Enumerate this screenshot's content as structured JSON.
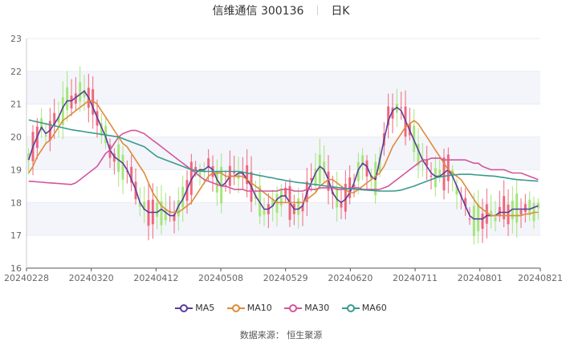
{
  "header": {
    "stock_name": "信维通信",
    "stock_code": "300136",
    "period": "日K"
  },
  "source_text": "数据来源： 恒生聚源",
  "colors": {
    "up": "#a4e67a",
    "down": "#f0667b",
    "grid": "#e8ecf4",
    "band": "#f3f5fb",
    "axis": "#666666"
  },
  "chart_data": {
    "type": "candlestick",
    "ylim": [
      16,
      23
    ],
    "y_ticks": [
      "16",
      "17",
      "18",
      "19",
      "20",
      "21",
      "22",
      "23"
    ],
    "x_tick_labels": [
      "20240228",
      "20240320",
      "20240412",
      "20240508",
      "20240529",
      "20240620",
      "20240711",
      "20240801",
      "20240821"
    ],
    "x_tick_indices": [
      0,
      15,
      30,
      45,
      60,
      75,
      90,
      105,
      119
    ],
    "moving_averages": [
      {
        "name": "MA5",
        "color": "#5a3d9a",
        "values": [
          19.3,
          19.7,
          20.0,
          20.3,
          20.1,
          20.2,
          20.4,
          20.6,
          20.9,
          21.1,
          21.1,
          21.2,
          21.3,
          21.4,
          21.2,
          20.9,
          20.6,
          20.3,
          20.0,
          19.6,
          19.4,
          19.3,
          19.2,
          19.0,
          18.7,
          18.4,
          18.0,
          17.8,
          17.7,
          17.7,
          17.7,
          17.8,
          17.7,
          17.6,
          17.6,
          17.9,
          18.1,
          18.4,
          18.7,
          18.9,
          19.0,
          19.0,
          19.1,
          19.0,
          18.7,
          18.5,
          18.6,
          18.8,
          18.8,
          18.9,
          18.9,
          18.7,
          18.5,
          18.2,
          18.0,
          17.8,
          17.8,
          17.9,
          18.1,
          18.2,
          18.2,
          18.0,
          17.8,
          17.8,
          17.9,
          18.3,
          18.6,
          18.9,
          19.1,
          19.0,
          18.7,
          18.3,
          18.1,
          18.0,
          18.1,
          18.3,
          18.6,
          19.0,
          19.2,
          19.1,
          18.8,
          18.7,
          19.3,
          19.9,
          20.5,
          20.8,
          20.9,
          20.8,
          20.5,
          20.2,
          19.9,
          19.6,
          19.3,
          19.1,
          18.9,
          18.8,
          18.8,
          18.9,
          19.0,
          18.8,
          18.5,
          18.2,
          17.9,
          17.6,
          17.5,
          17.5,
          17.5,
          17.6,
          17.6,
          17.6,
          17.7,
          17.7,
          17.7,
          17.8,
          17.8,
          17.8,
          17.8,
          17.8,
          17.85,
          17.9
        ]
      },
      {
        "name": "MA10",
        "color": "#e08a3a",
        "values": [
          18.9,
          19.1,
          19.4,
          19.6,
          19.8,
          19.9,
          20.1,
          20.3,
          20.5,
          20.6,
          20.7,
          20.8,
          20.9,
          21.0,
          21.1,
          21.1,
          21.0,
          20.8,
          20.6,
          20.4,
          20.2,
          20.0,
          19.8,
          19.7,
          19.5,
          19.3,
          19.1,
          18.9,
          18.6,
          18.3,
          18.1,
          17.9,
          17.8,
          17.7,
          17.7,
          17.7,
          17.8,
          17.9,
          18.0,
          18.2,
          18.4,
          18.6,
          18.8,
          18.9,
          18.9,
          18.9,
          18.8,
          18.8,
          18.8,
          18.8,
          18.8,
          18.7,
          18.6,
          18.5,
          18.4,
          18.3,
          18.2,
          18.1,
          18.0,
          18.0,
          18.0,
          18.0,
          18.0,
          18.0,
          18.0,
          18.1,
          18.2,
          18.3,
          18.5,
          18.6,
          18.7,
          18.7,
          18.6,
          18.5,
          18.4,
          18.3,
          18.3,
          18.4,
          18.5,
          18.6,
          18.7,
          18.8,
          18.9,
          19.1,
          19.4,
          19.7,
          19.9,
          20.1,
          20.3,
          20.4,
          20.5,
          20.4,
          20.2,
          20.0,
          19.8,
          19.6,
          19.4,
          19.2,
          19.0,
          18.9,
          18.8,
          18.7,
          18.5,
          18.3,
          18.1,
          17.9,
          17.8,
          17.7,
          17.6,
          17.6,
          17.6,
          17.6,
          17.6,
          17.6,
          17.6,
          17.6,
          17.65,
          17.65,
          17.7,
          17.7
        ]
      },
      {
        "name": "MA30",
        "color": "#d4559c",
        "values": [
          18.65,
          18.64,
          18.63,
          18.62,
          18.61,
          18.6,
          18.59,
          18.58,
          18.57,
          18.56,
          18.55,
          18.6,
          18.7,
          18.8,
          18.9,
          19.0,
          19.1,
          19.3,
          19.5,
          19.6,
          19.8,
          20.0,
          20.1,
          20.15,
          20.2,
          20.2,
          20.15,
          20.1,
          20.0,
          19.9,
          19.8,
          19.7,
          19.6,
          19.5,
          19.4,
          19.3,
          19.2,
          19.1,
          19.0,
          18.9,
          18.8,
          18.7,
          18.65,
          18.6,
          18.55,
          18.5,
          18.5,
          18.45,
          18.4,
          18.4,
          18.4,
          18.35,
          18.35,
          18.35,
          18.35,
          18.35,
          18.35,
          18.35,
          18.35,
          18.4,
          18.4,
          18.4,
          18.35,
          18.35,
          18.35,
          18.4,
          18.4,
          18.4,
          18.45,
          18.45,
          18.45,
          18.45,
          18.4,
          18.4,
          18.4,
          18.45,
          18.45,
          18.45,
          18.4,
          18.4,
          18.4,
          18.4,
          18.4,
          18.45,
          18.5,
          18.6,
          18.7,
          18.8,
          18.9,
          19.0,
          19.1,
          19.2,
          19.3,
          19.3,
          19.35,
          19.35,
          19.35,
          19.3,
          19.3,
          19.3,
          19.3,
          19.3,
          19.3,
          19.25,
          19.2,
          19.2,
          19.1,
          19.05,
          19.0,
          19.0,
          19.0,
          19.0,
          18.95,
          18.9,
          18.9,
          18.9,
          18.85,
          18.8,
          18.75,
          18.7
        ]
      },
      {
        "name": "MA60",
        "color": "#3a9a8f",
        "values": [
          20.52,
          20.49,
          20.46,
          20.43,
          20.4,
          20.37,
          20.34,
          20.31,
          20.28,
          20.25,
          20.22,
          20.2,
          20.18,
          20.16,
          20.14,
          20.12,
          20.1,
          20.08,
          20.06,
          20.04,
          20.02,
          20.0,
          19.95,
          19.9,
          19.85,
          19.8,
          19.75,
          19.7,
          19.6,
          19.5,
          19.4,
          19.35,
          19.3,
          19.25,
          19.2,
          19.15,
          19.1,
          19.05,
          19.0,
          18.98,
          18.96,
          18.95,
          18.95,
          18.95,
          18.95,
          18.95,
          18.95,
          18.95,
          18.95,
          18.95,
          18.93,
          18.9,
          18.87,
          18.85,
          18.82,
          18.8,
          18.77,
          18.75,
          18.72,
          18.7,
          18.67,
          18.65,
          18.63,
          18.61,
          18.6,
          18.58,
          18.56,
          18.55,
          18.53,
          18.51,
          18.5,
          18.48,
          18.46,
          18.45,
          18.43,
          18.42,
          18.41,
          18.4,
          18.39,
          18.38,
          18.37,
          18.36,
          18.35,
          18.35,
          18.35,
          18.35,
          18.36,
          18.38,
          18.42,
          18.46,
          18.5,
          18.55,
          18.6,
          18.65,
          18.7,
          18.75,
          18.78,
          18.8,
          18.82,
          18.84,
          18.85,
          18.86,
          18.86,
          18.86,
          18.85,
          18.84,
          18.83,
          18.82,
          18.81,
          18.8,
          18.78,
          18.76,
          18.74,
          18.72,
          18.7,
          18.69,
          18.68,
          18.67,
          18.66,
          18.65
        ]
      }
    ]
  }
}
